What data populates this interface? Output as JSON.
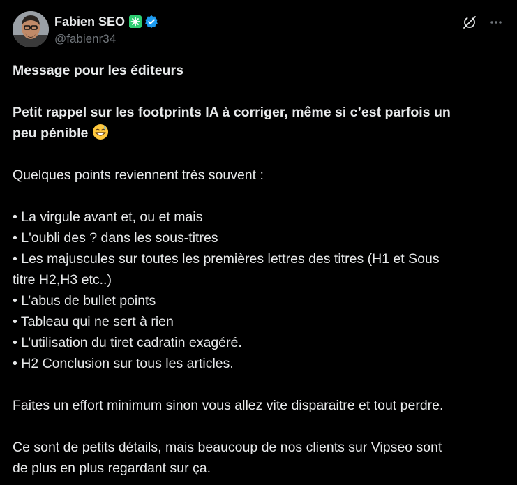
{
  "author": {
    "display_name": "Fabien SEO",
    "handle": "@fabienr34",
    "badge_icon": "sparkle-badge-icon",
    "verified_icon": "verified-badge-icon",
    "verified_color": "#1d9bf0",
    "badge_color": "#2ecc71"
  },
  "actions": {
    "grok_icon": "grok-icon",
    "more_icon": "more-icon"
  },
  "post": {
    "title": "Message pour les éditeurs",
    "subtitle_line1": "Petit rappel sur les footprints IA à corriger, même si c’est parfois un",
    "subtitle_line2": "peu pénible",
    "subtitle_emoji": "grinning-sweat-emoji",
    "intro": "Quelques points reviennent très souvent :",
    "bullets": [
      "• La virgule avant et, ou et mais",
      "• L'oubli des ? dans les sous-titres",
      "• Les majuscules sur toutes les premières lettres des titres (H1 et Sous",
      "titre H2,H3 etc..)",
      "• L’abus de bullet points",
      "• Tableau qui ne sert à rien",
      "• L’utilisation du tiret cadratin exagéré.",
      "• H2 Conclusion sur tous les articles."
    ],
    "warning": "Faites un effort minimum sinon vous allez vite disparaitre et tout perdre.",
    "closing_line1": "Ce sont de petits détails, mais beaucoup  de nos clients sur Vipseo sont",
    "closing_line2": "de plus en plus regardant sur ça."
  },
  "colors": {
    "background": "#000000",
    "text": "#e7e9ea",
    "muted": "#71767b"
  }
}
